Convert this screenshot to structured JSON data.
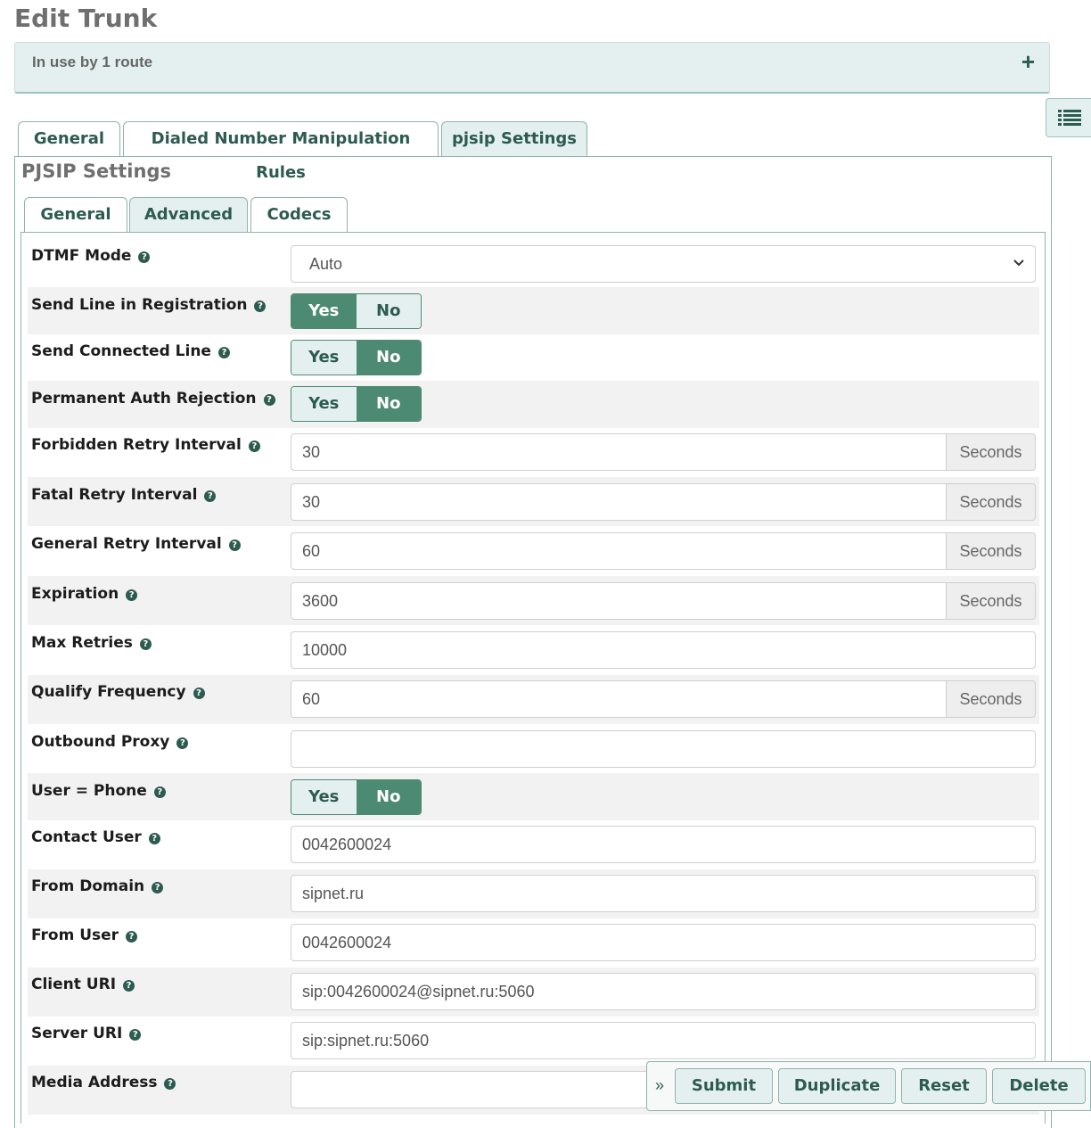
{
  "page": {
    "title": "Edit Trunk"
  },
  "usage": {
    "text": "In use by 1 route",
    "expand_symbol": "+"
  },
  "main_tabs": [
    {
      "label": "General",
      "active": false
    },
    {
      "label": "Dialed Number Manipulation Rules",
      "active": false
    },
    {
      "label": "pjsip Settings",
      "active": true
    }
  ],
  "section": {
    "title": "PJSIP Settings"
  },
  "sub_tabs": [
    {
      "label": "General",
      "active": false
    },
    {
      "label": "Advanced",
      "active": true
    },
    {
      "label": "Codecs",
      "active": false
    }
  ],
  "toggle_labels": {
    "yes": "Yes",
    "no": "No"
  },
  "addon_unit": "Seconds",
  "fields": {
    "dtmf_mode": {
      "label": "DTMF Mode",
      "value": "Auto"
    },
    "send_line": {
      "label": "Send Line in Registration",
      "value": "Yes"
    },
    "send_connected": {
      "label": "Send Connected Line",
      "value": "No"
    },
    "perm_auth": {
      "label": "Permanent Auth Rejection",
      "value": "No"
    },
    "forbidden_retry": {
      "label": "Forbidden Retry Interval",
      "value": "30"
    },
    "fatal_retry": {
      "label": "Fatal Retry Interval",
      "value": "30"
    },
    "general_retry": {
      "label": "General Retry Interval",
      "value": "60"
    },
    "expiration": {
      "label": "Expiration",
      "value": "3600"
    },
    "max_retries": {
      "label": "Max Retries",
      "value": "10000"
    },
    "qualify_freq": {
      "label": "Qualify Frequency",
      "value": "60"
    },
    "outbound_proxy": {
      "label": "Outbound Proxy",
      "value": ""
    },
    "user_phone": {
      "label": "User = Phone",
      "value": "No"
    },
    "contact_user": {
      "label": "Contact User",
      "value": "0042600024"
    },
    "from_domain": {
      "label": "From Domain",
      "value": "sipnet.ru"
    },
    "from_user": {
      "label": "From User",
      "value": "0042600024"
    },
    "client_uri": {
      "label": "Client URI",
      "value": "sip:0042600024@sipnet.ru:5060"
    },
    "server_uri": {
      "label": "Server URI",
      "value": "sip:sipnet.ru:5060"
    },
    "media_address": {
      "label": "Media Address",
      "value": ""
    }
  },
  "actions": {
    "collapse": "»",
    "submit": "Submit",
    "duplicate": "Duplicate",
    "reset": "Reset",
    "delete": "Delete"
  },
  "icons": {
    "help": "question-circle-icon",
    "side_toggle": "list-icon",
    "select_arrow": "chevron-down-icon"
  },
  "colors": {
    "accent": "#4d8a73",
    "accent_dark": "#2d5b50",
    "tab_active_bg": "#e4f0ef",
    "row_alt_bg": "#f2f2f2"
  }
}
